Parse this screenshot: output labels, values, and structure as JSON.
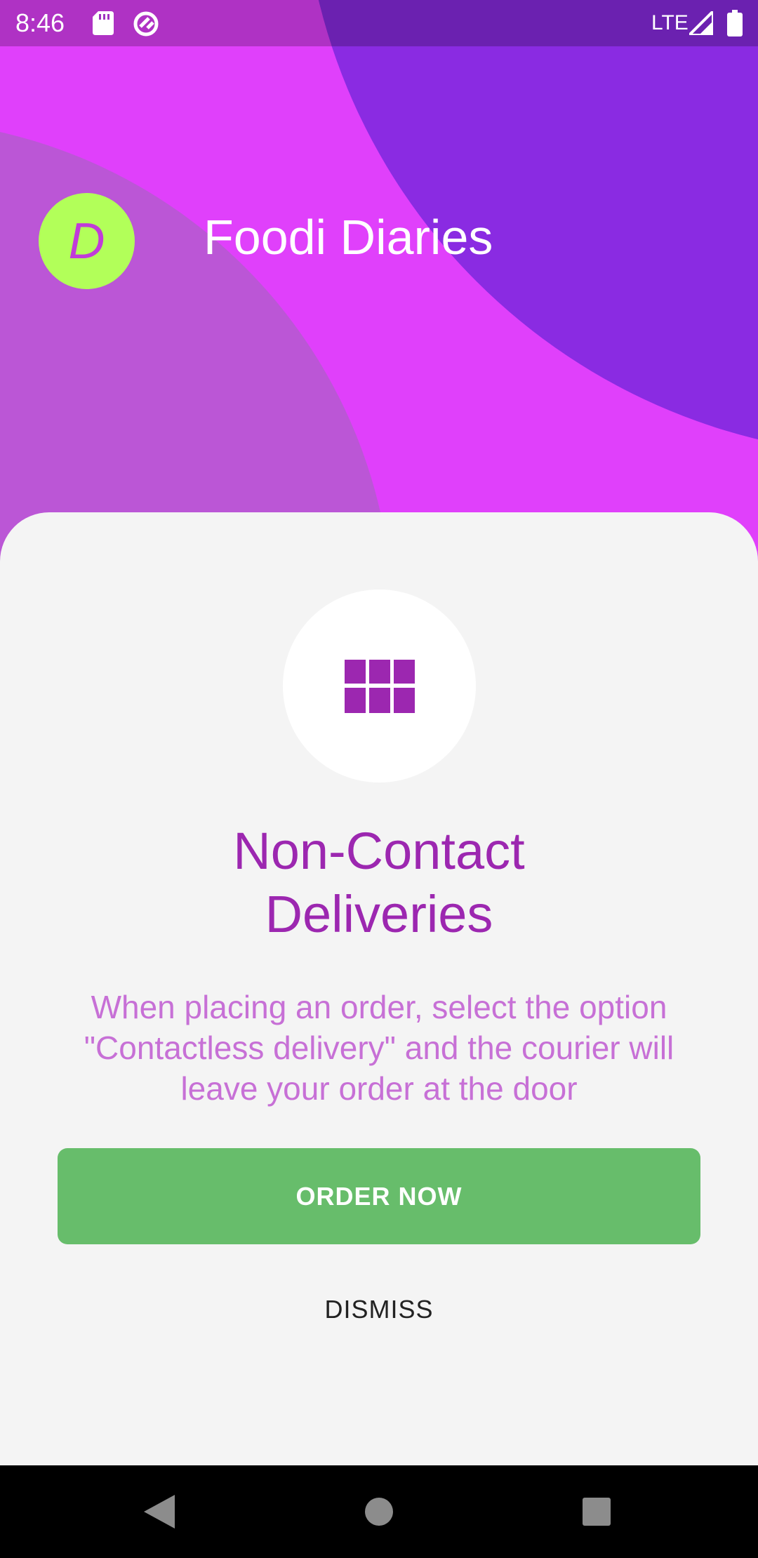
{
  "status_bar": {
    "time": "8:46",
    "network": "LTE",
    "icons": [
      "sd-card-icon",
      "sync-icon",
      "signal-icon",
      "battery-icon"
    ]
  },
  "header": {
    "avatar_letter": "D",
    "app_title": "Foodi Diaries"
  },
  "promo": {
    "icon": "grid-icon",
    "headline_line1": "Non-Contact",
    "headline_line2": "Deliveries",
    "body_line1": "When placing an order, select the option",
    "body_line2": "\"Contactless delivery\" and the courier will",
    "body_line3": "leave your order at the door",
    "primary_button": "ORDER NOW",
    "secondary_button": "DISMISS"
  },
  "nav_bar": {
    "icons": [
      "back-icon",
      "home-icon",
      "recents-icon"
    ]
  },
  "colors": {
    "background": "#e040fb",
    "dark_blob": "#8a2be2",
    "light_blob": "#bb56d6",
    "avatar": "#b2ff59",
    "accent": "#9c27b0",
    "body_text": "#c770d6",
    "primary_button": "#67bd6b",
    "sheet": "#f4f4f4"
  }
}
